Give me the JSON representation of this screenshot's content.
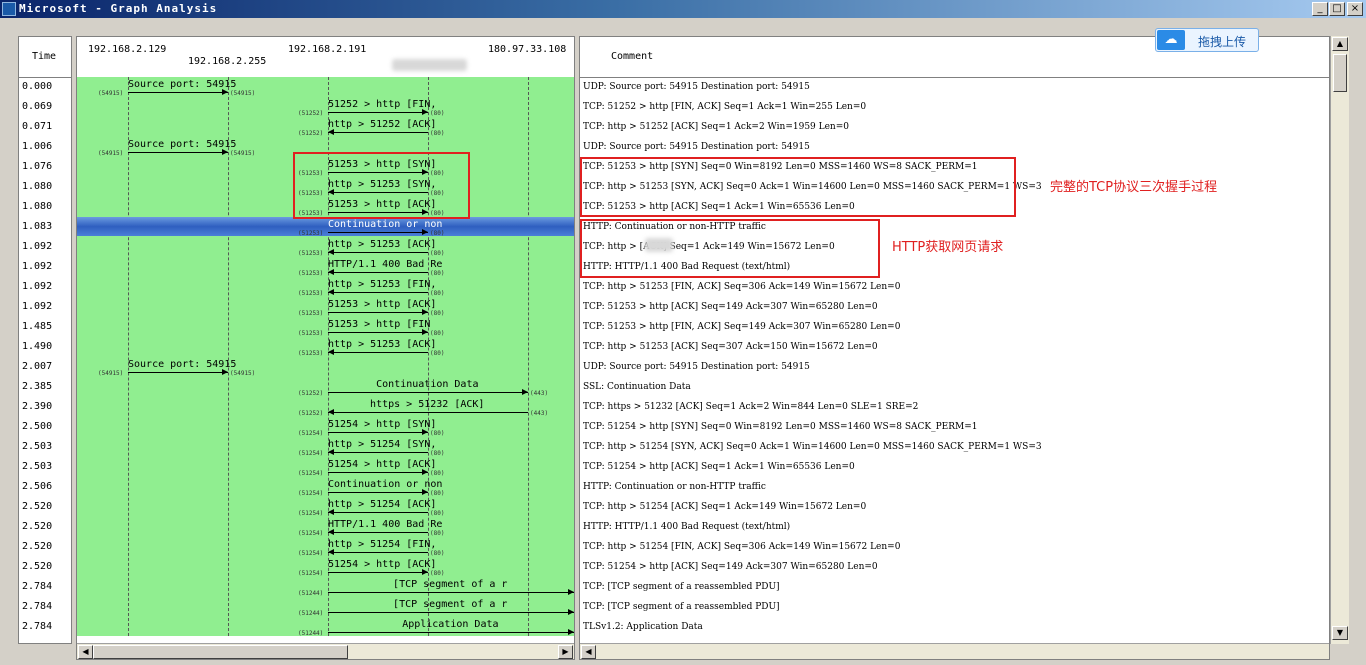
{
  "window": {
    "title": "Microsoft - Graph Analysis"
  },
  "window_buttons": [
    "_",
    "□",
    "×"
  ],
  "headers": {
    "time": "Time",
    "comment": "Comment",
    "hosts": [
      "192.168.2.129",
      "192.168.2.255",
      "192.168.2.191",
      "180.97.33.108"
    ]
  },
  "upload": {
    "label": "拖拽上传"
  },
  "annotations": {
    "handshake": "完整的TCP协议三次握手过程",
    "http": "HTTP获取网页请求"
  },
  "rows": [
    {
      "time": "0.000",
      "comment": "UDP: Source port: 54915  Destination port: 54915",
      "label": "Source port: 54915",
      "from": 0,
      "to": 1,
      "src_port": "(54915)",
      "dst_port": "(54915)"
    },
    {
      "time": "0.069",
      "comment": "TCP: 51252 > http [FIN, ACK] Seq=1 Ack=1 Win=255 Len=0",
      "label": "51252 > http [FIN,",
      "from": 2,
      "to": 3,
      "src_port": "(51252)",
      "dst_port": "(80)"
    },
    {
      "time": "0.071",
      "comment": "TCP: http > 51252 [ACK] Seq=1 Ack=2 Win=1959 Len=0",
      "label": "http > 51252 [ACK]",
      "from": 3,
      "to": 2,
      "src_port": "(51252)",
      "dst_port": "(80)"
    },
    {
      "time": "1.006",
      "comment": "UDP: Source port: 54915  Destination port: 54915",
      "label": "Source port: 54915",
      "from": 0,
      "to": 1,
      "src_port": "(54915)",
      "dst_port": "(54915)"
    },
    {
      "time": "1.076",
      "comment": "TCP: 51253 > http [SYN] Seq=0 Win=8192 Len=0 MSS=1460 WS=8 SACK_PERM=1",
      "label": "51253 > http [SYN]",
      "from": 2,
      "to": 3,
      "src_port": "(51253)",
      "dst_port": "(80)"
    },
    {
      "time": "1.080",
      "comment": "TCP: http > 51253 [SYN, ACK] Seq=0 Ack=1 Win=14600 Len=0 MSS=1460 SACK_PERM=1 WS=3",
      "label": "http > 51253 [SYN,",
      "from": 3,
      "to": 2,
      "src_port": "(51253)",
      "dst_port": "(80)"
    },
    {
      "time": "1.080",
      "comment": "TCP: 51253 > http [ACK] Seq=1 Ack=1 Win=65536 Len=0",
      "label": "51253 > http [ACK]",
      "from": 2,
      "to": 3,
      "src_port": "(51253)",
      "dst_port": "(80)"
    },
    {
      "time": "1.083",
      "comment": "HTTP: Continuation or non-HTTP traffic",
      "label": "Continuation or non",
      "from": 2,
      "to": 3,
      "src_port": "(51253)",
      "dst_port": "(80)",
      "selected": true
    },
    {
      "time": "1.092",
      "comment": "TCP: http >      [ACK] Seq=1 Ack=149 Win=15672 Len=0",
      "label": "http > 51253 [ACK]",
      "from": 3,
      "to": 2,
      "src_port": "(51253)",
      "dst_port": "(80)"
    },
    {
      "time": "1.092",
      "comment": "HTTP: HTTP/1.1 400 Bad Request  (text/html)",
      "label": "HTTP/1.1 400 Bad Re",
      "from": 3,
      "to": 2,
      "src_port": "(51253)",
      "dst_port": "(80)"
    },
    {
      "time": "1.092",
      "comment": "TCP: http > 51253 [FIN, ACK] Seq=306 Ack=149 Win=15672 Len=0",
      "label": "http > 51253 [FIN,",
      "from": 3,
      "to": 2,
      "src_port": "(51253)",
      "dst_port": "(80)"
    },
    {
      "time": "1.092",
      "comment": "TCP: 51253 > http [ACK] Seq=149 Ack=307 Win=65280 Len=0",
      "label": "51253 > http [ACK]",
      "from": 2,
      "to": 3,
      "src_port": "(51253)",
      "dst_port": "(80)"
    },
    {
      "time": "1.485",
      "comment": "TCP: 51253 > http [FIN, ACK] Seq=149 Ack=307 Win=65280 Len=0",
      "label": "51253 > http [FIN",
      "from": 2,
      "to": 3,
      "src_port": "(51253)",
      "dst_port": "(80)"
    },
    {
      "time": "1.490",
      "comment": "TCP: http > 51253 [ACK] Seq=307 Ack=150 Win=15672 Len=0",
      "label": "http > 51253 [ACK]",
      "from": 3,
      "to": 2,
      "src_port": "(51253)",
      "dst_port": "(80)"
    },
    {
      "time": "2.007",
      "comment": "UDP: Source port: 54915  Destination port: 54915",
      "label": "Source port: 54915",
      "from": 0,
      "to": 1,
      "src_port": "(54915)",
      "dst_port": "(54915)"
    },
    {
      "time": "2.385",
      "comment": "SSL: Continuation Data",
      "label": "Continuation Data",
      "from": 2,
      "to": 4,
      "src_port": "(51252)",
      "dst_port": "(443)"
    },
    {
      "time": "2.390",
      "comment": "TCP: https > 51232 [ACK] Seq=1 Ack=2 Win=844 Len=0 SLE=1 SRE=2",
      "label": "https > 51232 [ACK]",
      "from": 4,
      "to": 2,
      "src_port": "(51252)",
      "dst_port": "(443)"
    },
    {
      "time": "2.500",
      "comment": "TCP: 51254 > http [SYN] Seq=0 Win=8192 Len=0 MSS=1460 WS=8 SACK_PERM=1",
      "label": "51254 > http [SYN]",
      "from": 2,
      "to": 3,
      "src_port": "(51254)",
      "dst_port": "(80)"
    },
    {
      "time": "2.503",
      "comment": "TCP: http > 51254 [SYN, ACK] Seq=0 Ack=1 Win=14600 Len=0 MSS=1460 SACK_PERM=1 WS=3",
      "label": "http > 51254 [SYN,",
      "from": 3,
      "to": 2,
      "src_port": "(51254)",
      "dst_port": "(80)"
    },
    {
      "time": "2.503",
      "comment": "TCP: 51254 > http [ACK] Seq=1 Ack=1 Win=65536 Len=0",
      "label": "51254 > http [ACK]",
      "from": 2,
      "to": 3,
      "src_port": "(51254)",
      "dst_port": "(80)"
    },
    {
      "time": "2.506",
      "comment": "HTTP: Continuation or non-HTTP traffic",
      "label": "Continuation or non",
      "from": 2,
      "to": 3,
      "src_port": "(51254)",
      "dst_port": "(80)"
    },
    {
      "time": "2.520",
      "comment": "TCP: http > 51254 [ACK] Seq=1 Ack=149 Win=15672 Len=0",
      "label": "http > 51254 [ACK]",
      "from": 3,
      "to": 2,
      "src_port": "(51254)",
      "dst_port": "(80)"
    },
    {
      "time": "2.520",
      "comment": "HTTP: HTTP/1.1 400 Bad Request  (text/html)",
      "label": "HTTP/1.1 400 Bad Re",
      "from": 3,
      "to": 2,
      "src_port": "(51254)",
      "dst_port": "(80)"
    },
    {
      "time": "2.520",
      "comment": "TCP: http > 51254 [FIN, ACK] Seq=306 Ack=149 Win=15672 Len=0",
      "label": "http > 51254 [FIN,",
      "from": 3,
      "to": 2,
      "src_port": "(51254)",
      "dst_port": "(80)"
    },
    {
      "time": "2.520",
      "comment": "TCP: 51254 > http [ACK] Seq=149 Ack=307 Win=65280 Len=0",
      "label": "51254 > http [ACK]",
      "from": 2,
      "to": 3,
      "src_port": "(51254)",
      "dst_port": "(80)"
    },
    {
      "time": "2.784",
      "comment": "TCP: [TCP segment of a reassembled PDU]",
      "label": "[TCP segment of a r",
      "from": 2,
      "to": 5,
      "src_port": "(51244)",
      "dst_port": ""
    },
    {
      "time": "2.784",
      "comment": "TCP: [TCP segment of a reassembled PDU]",
      "label": "[TCP segment of a r",
      "from": 2,
      "to": 5,
      "src_port": "(51244)",
      "dst_port": ""
    },
    {
      "time": "2.784",
      "comment": "TLSv1.2: Application Data",
      "label": "Application Data",
      "from": 2,
      "to": 5,
      "src_port": "(51244)",
      "dst_port": ""
    }
  ]
}
